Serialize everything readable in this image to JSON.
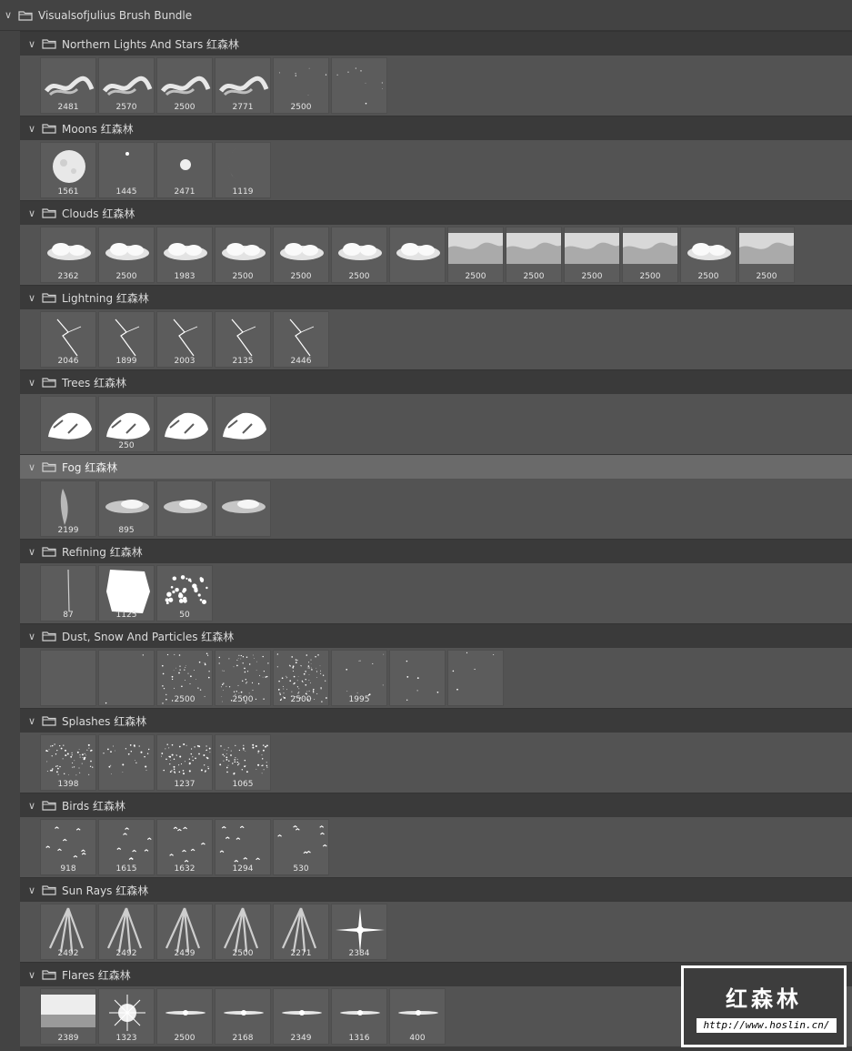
{
  "root": {
    "title": "Visualsofjulius Brush Bundle"
  },
  "groups": [
    {
      "name": "Northern Lights And Stars 红森林",
      "tiles": [
        {
          "n": "2481",
          "k": "aurora1"
        },
        {
          "n": "2570",
          "k": "aurora2"
        },
        {
          "n": "2500",
          "k": "aurora3"
        },
        {
          "n": "2771",
          "k": "aurora4"
        },
        {
          "n": "2500",
          "k": "stars1"
        },
        {
          "n": "",
          "k": "stars2"
        }
      ]
    },
    {
      "name": "Moons 红森林",
      "tiles": [
        {
          "n": "1561",
          "k": "moonfull"
        },
        {
          "n": "1445",
          "k": "moondot"
        },
        {
          "n": "2471",
          "k": "moonsmall"
        },
        {
          "n": "1119",
          "k": "crescent"
        }
      ]
    },
    {
      "name": "Clouds 红森林",
      "tiles": [
        {
          "n": "2362",
          "k": "cloud1"
        },
        {
          "n": "2500",
          "k": "cloud2"
        },
        {
          "n": "1983",
          "k": "cloud3"
        },
        {
          "n": "2500",
          "k": "cloud4"
        },
        {
          "n": "2500",
          "k": "cloud5"
        },
        {
          "n": "2500",
          "k": "cloud6"
        },
        {
          "n": "",
          "k": "cloud7"
        },
        {
          "n": "2500",
          "k": "cloud8"
        },
        {
          "n": "2500",
          "k": "cloud9"
        },
        {
          "n": "2500",
          "k": "cloud10"
        },
        {
          "n": "2500",
          "k": "cloud11"
        },
        {
          "n": "2500",
          "k": "cloud12"
        },
        {
          "n": "2500",
          "k": "cloud13"
        }
      ]
    },
    {
      "name": "Lightning 红森林",
      "tiles": [
        {
          "n": "2046",
          "k": "bolt1"
        },
        {
          "n": "1899",
          "k": "bolt2"
        },
        {
          "n": "2003",
          "k": "bolt3"
        },
        {
          "n": "2135",
          "k": "bolt4"
        },
        {
          "n": "2446",
          "k": "bolt5"
        }
      ]
    },
    {
      "name": "Trees 红森林",
      "tiles": [
        {
          "n": "",
          "k": "tree1"
        },
        {
          "n": "250",
          "k": "tree2"
        },
        {
          "n": "",
          "k": "tree3"
        },
        {
          "n": "",
          "k": "tree4"
        }
      ]
    },
    {
      "name": "Fog 红森林",
      "selected": true,
      "tiles": [
        {
          "n": "2199",
          "k": "fog1"
        },
        {
          "n": "895",
          "k": "fog2"
        },
        {
          "n": "",
          "k": "fog3"
        },
        {
          "n": "",
          "k": "fog4"
        }
      ]
    },
    {
      "name": "Refining 红森林",
      "tiles": [
        {
          "n": "87",
          "k": "refine1"
        },
        {
          "n": "1125",
          "k": "refine2"
        },
        {
          "n": "50",
          "k": "refine3"
        }
      ]
    },
    {
      "name": "Dust, Snow And Particles 红森林",
      "tiles": [
        {
          "n": "",
          "k": "dust1"
        },
        {
          "n": "",
          "k": "dust2"
        },
        {
          "n": "2500",
          "k": "dust3"
        },
        {
          "n": "2500",
          "k": "dust4"
        },
        {
          "n": "2500",
          "k": "dust5"
        },
        {
          "n": "1995",
          "k": "dust6"
        },
        {
          "n": "",
          "k": "dust7"
        },
        {
          "n": "",
          "k": "dust8"
        }
      ]
    },
    {
      "name": "Splashes 红森林",
      "tiles": [
        {
          "n": "1398",
          "k": "splash1"
        },
        {
          "n": "",
          "k": "splash2"
        },
        {
          "n": "1237",
          "k": "splash3"
        },
        {
          "n": "1065",
          "k": "splash4"
        }
      ]
    },
    {
      "name": "Birds 红森林",
      "tiles": [
        {
          "n": "918",
          "k": "birds1"
        },
        {
          "n": "1615",
          "k": "birds2"
        },
        {
          "n": "1632",
          "k": "birds3"
        },
        {
          "n": "1294",
          "k": "birds4"
        },
        {
          "n": "530",
          "k": "birds5"
        }
      ]
    },
    {
      "name": "Sun Rays 红森林",
      "tiles": [
        {
          "n": "2492",
          "k": "rays1"
        },
        {
          "n": "2492",
          "k": "rays2"
        },
        {
          "n": "2459",
          "k": "rays3"
        },
        {
          "n": "2500",
          "k": "rays4"
        },
        {
          "n": "2271",
          "k": "rays5"
        },
        {
          "n": "2384",
          "k": "rays6"
        }
      ]
    },
    {
      "name": "Flares 红森林",
      "tiles": [
        {
          "n": "2389",
          "k": "flare1"
        },
        {
          "n": "1323",
          "k": "flare2"
        },
        {
          "n": "2500",
          "k": "flare3"
        },
        {
          "n": "2168",
          "k": "flare4"
        },
        {
          "n": "2349",
          "k": "flare5"
        },
        {
          "n": "1316",
          "k": "flare6"
        },
        {
          "n": "400",
          "k": "flare7"
        }
      ]
    }
  ],
  "watermark": {
    "title": "红森林",
    "url": "http://www.hoslin.cn/"
  },
  "icons": {
    "expand": "chevron-down-icon",
    "folder": "folder-icon"
  },
  "colors": {
    "panel": "#535353",
    "header": "#3a3a3a",
    "selected": "#6a6a6a",
    "tile": "#5c5c5c"
  }
}
